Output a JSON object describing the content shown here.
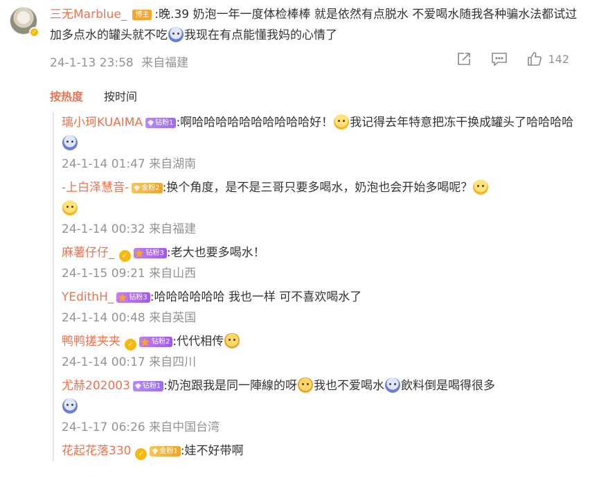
{
  "main_comment": {
    "username": "三无Marblue_",
    "role_tag": "博主",
    "text_part1": ":晚.39 奶泡一年一度体检棒棒 就是依然有点脱水 不爱喝水随我各种骗水法都试过 加多点水的罐头就不吃",
    "text_part2": "我现在有点能懂我妈的心情了",
    "emoji1": "crying-emoji",
    "date": "24-1-13 23:58",
    "location": "来自福建",
    "like_count": "142"
  },
  "tabs": {
    "hot": "按热度",
    "time": "按时间"
  },
  "replies": [
    {
      "username": "璃小珂KUAIMA",
      "badge": "钻粉1",
      "text1": ":啊哈哈哈哈哈哈哈哈哈哈好！",
      "text2": "我记得去年特意把冻干换成罐头了哈哈哈哈",
      "date": "24-1-14 01:47",
      "location": "来自湖南"
    },
    {
      "username": "-上白泽慧音-",
      "badge": "金粉2",
      "text1": ":换个角度，是不是三哥只要多喝水，奶泡也会开始多喝呢？",
      "date": "24-1-14 00:32",
      "location": "来自福建"
    },
    {
      "username": "麻薯仔仔_",
      "badge": "钻粉3",
      "text1": ":老大也要多喝水！",
      "date": "24-1-15 09:21",
      "location": "来自山西"
    },
    {
      "username": "YEdithH_",
      "badge": "钻粉3",
      "text1": ":哈哈哈哈哈哈 我也一样 可不喜欢喝水了",
      "date": "24-1-14 00:48",
      "location": "来自英国"
    },
    {
      "username": "鸭鸭搓夹夹",
      "badge": "钻粉2",
      "text1": ":代代相传",
      "date": "24-1-14 00:17",
      "location": "来自四川"
    },
    {
      "username": "尤赫202003",
      "badge": "钻粉1",
      "text1": ":奶泡跟我是同一陣線的呀",
      "text2": "我也不爱喝水",
      "text3": "飲料倒是喝得很多",
      "date": "24-1-17 06:26",
      "location": "来自中国台湾"
    },
    {
      "username": "花起花落330",
      "badge": "金粉1",
      "text1": ":娃不好带啊"
    }
  ],
  "colors": {
    "accent": "#eb7350",
    "meta": "#939393",
    "text": "#333333"
  }
}
